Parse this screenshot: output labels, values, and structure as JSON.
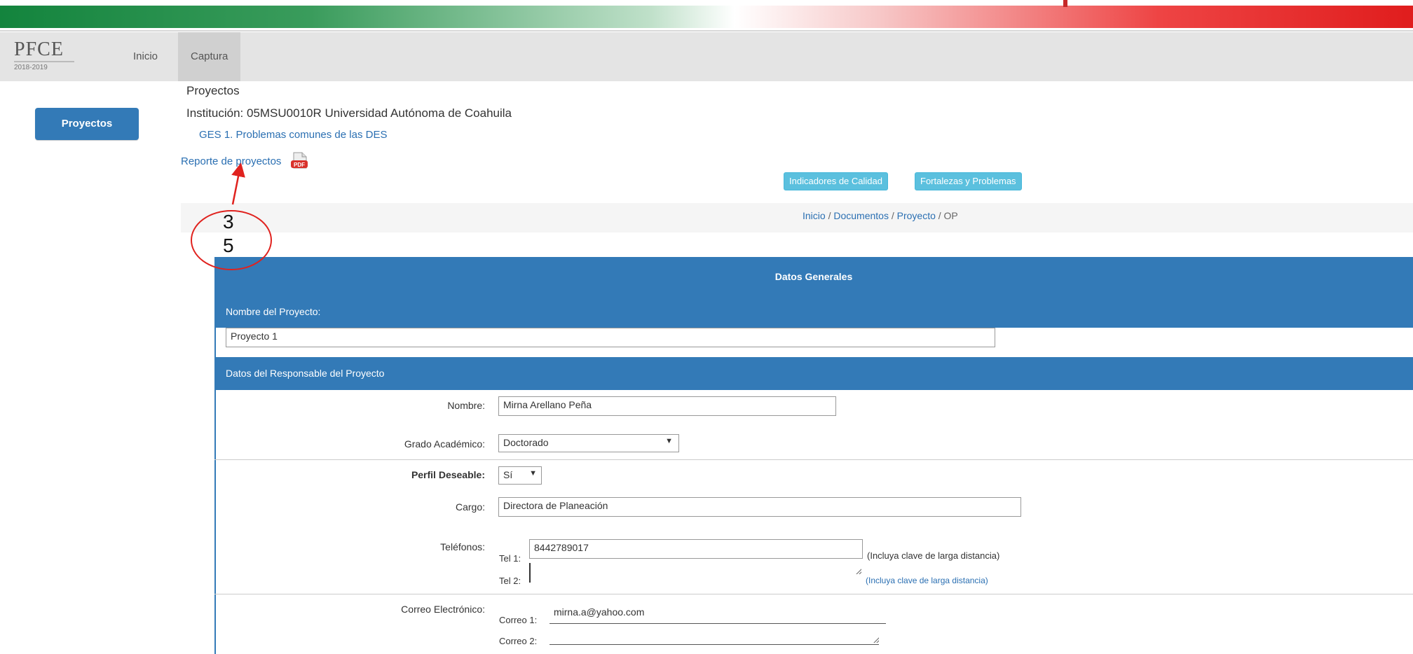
{
  "colors": {
    "brand_green": "#13843d",
    "brand_red": "#e01d1d",
    "primary_blue": "#337ab7",
    "info_cyan": "#5bc0de",
    "annotation_red": "#e0221e"
  },
  "logo": {
    "title": "PFCE",
    "subtitle": "2018-2019"
  },
  "nav": {
    "items": [
      {
        "label": "Inicio"
      },
      {
        "label": "Captura"
      }
    ]
  },
  "sidebar": {
    "button_label": "Proyectos"
  },
  "header": {
    "title": "Proyectos",
    "institution": "Institución: 05MSU0010R Universidad Autónoma de Coahuila",
    "problem_link": "GES 1. Problemas comunes de las DES",
    "report_link": "Reporte de proyectos",
    "report_icon": "pdf-icon"
  },
  "actions": {
    "quality_label": "Indicadores de Calidad",
    "strengths_label": "Fortalezas y Problemas"
  },
  "breadcrumb": [
    "Inicio",
    "Documentos",
    "Proyecto",
    "OP"
  ],
  "annotation": {
    "line1": "3",
    "line2": "5"
  },
  "form": {
    "section_title": "Datos Generales",
    "project_name_header": "Nombre del Proyecto:",
    "project_name_value": "Proyecto 1",
    "responsible_header": "Datos del Responsable del Proyecto",
    "name_label": "Nombre:",
    "name_value": "Mirna Arellano Peña",
    "degree_label": "Grado Académico:",
    "degree_value": "Doctorado",
    "profile_label": "Perfil Deseable:",
    "profile_value": "Sí",
    "position_label": "Cargo:",
    "position_value": "Directora de Planeación",
    "phone_label": "Teléfonos:",
    "phone1_label": "Tel 1:",
    "phone1_value": "8442789017",
    "phone1_hint": "(Incluya clave de larga distancia)",
    "phone2_label": "Tel 2:",
    "phone2_hint": "(Incluya clave de larga distancia)",
    "email_label": "Correo Electrónico:",
    "email1_label": "Correo 1:",
    "email1_value": "mirna.a@yahoo.com",
    "email2_label": "Correo 2:"
  }
}
